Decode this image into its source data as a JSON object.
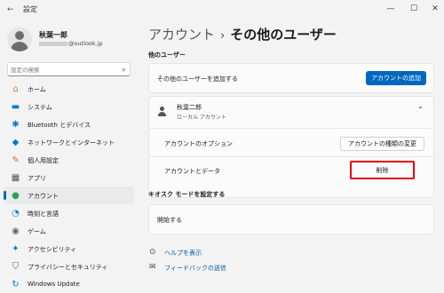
{
  "window": {
    "title": "設定",
    "app_icon": "back-arrow-icon",
    "controls": {
      "minimize": "—",
      "maximize": "☐",
      "close": "✕"
    }
  },
  "profile": {
    "name": "秋葉一郎",
    "email_suffix": "@outlook.jp"
  },
  "search": {
    "placeholder": "設定の検索",
    "icon": "search-icon"
  },
  "sidebar": {
    "items": [
      {
        "label": "ホーム",
        "icon": "home-icon",
        "glyph": "⌂",
        "color": "#c47e2f",
        "active": false
      },
      {
        "label": "システム",
        "icon": "system-icon",
        "glyph": "▬",
        "color": "#0078d4",
        "active": false
      },
      {
        "label": "Bluetooth とデバイス",
        "icon": "bluetooth-icon",
        "glyph": "✱",
        "color": "#0078d4",
        "active": false
      },
      {
        "label": "ネットワークとインターネット",
        "icon": "network-icon",
        "glyph": "◆",
        "color": "#0078d4",
        "active": false
      },
      {
        "label": "個人用設定",
        "icon": "personalization-icon",
        "glyph": "✎",
        "color": "#d06e2b",
        "active": false
      },
      {
        "label": "アプリ",
        "icon": "apps-icon",
        "glyph": "▦",
        "color": "#555555",
        "active": false
      },
      {
        "label": "アカウント",
        "icon": "accounts-icon",
        "glyph": "●",
        "color": "#2aa05a",
        "active": true
      },
      {
        "label": "時刻と言語",
        "icon": "time-language-icon",
        "glyph": "◔",
        "color": "#0078d4",
        "active": false
      },
      {
        "label": "ゲーム",
        "icon": "gaming-icon",
        "glyph": "◉",
        "color": "#666666",
        "active": false
      },
      {
        "label": "アクセシビリティ",
        "icon": "accessibility-icon",
        "glyph": "✦",
        "color": "#0078d4",
        "active": false
      },
      {
        "label": "プライバシーとセキュリティ",
        "icon": "privacy-icon",
        "glyph": "⛉",
        "color": "#666666",
        "active": false
      },
      {
        "label": "Windows Update",
        "icon": "windows-update-icon",
        "glyph": "↻",
        "color": "#0078d4",
        "active": false
      }
    ]
  },
  "header": {
    "breadcrumb": "アカウント",
    "separator": "›",
    "current": "その他のユーザー"
  },
  "other_users": {
    "section_title": "他のユーザー",
    "add_row_label": "その他のユーザーを追加する",
    "add_button": "アカウントの追加",
    "user": {
      "name": "秋葉二郎",
      "type": "ローカル アカウント",
      "expand_icon": "chevron-up-icon",
      "options_label": "アカウントのオプション",
      "change_type_button": "アカウントの種類の変更",
      "data_label": "アカウントとデータ",
      "remove_button": "削除"
    }
  },
  "kiosk": {
    "section_title": "キオスク モードを設定する",
    "start_label": "開始する"
  },
  "links": {
    "help": "ヘルプを表示",
    "feedback": "フィードバックの送信"
  },
  "colors": {
    "accent": "#0067c0",
    "highlight": "#e3000f",
    "link": "#0058a3"
  }
}
